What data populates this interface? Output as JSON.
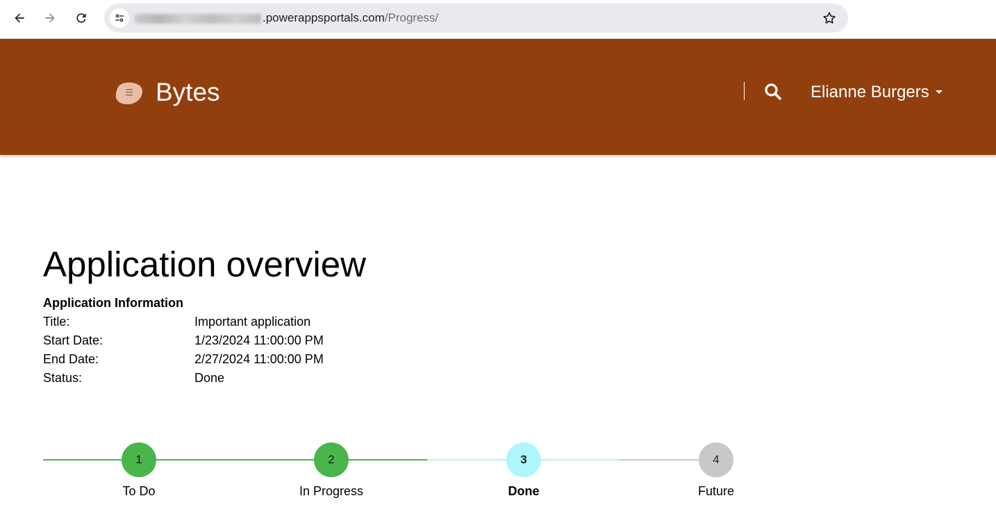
{
  "browser": {
    "url_host": ".powerappsportals.com",
    "url_path": "/Progress/"
  },
  "header": {
    "brand": "Bytes",
    "user_name": "Elianne Burgers",
    "colors": {
      "background": "#923f0e",
      "text": "#ffffff"
    }
  },
  "main": {
    "title": "Application overview",
    "info_heading": "Application Information",
    "info": [
      {
        "label": "Title:",
        "value": "Important application"
      },
      {
        "label": "Start Date:",
        "value": "1/23/2024 11:00:00 PM"
      },
      {
        "label": "End Date:",
        "value": "2/27/2024 11:00:00 PM"
      },
      {
        "label": "Status:",
        "value": "Done"
      }
    ]
  },
  "progress": {
    "steps": [
      {
        "number": "1",
        "label": "To Do",
        "state": "completed"
      },
      {
        "number": "2",
        "label": "In Progress",
        "state": "completed"
      },
      {
        "number": "3",
        "label": "Done",
        "state": "current"
      },
      {
        "number": "4",
        "label": "Future",
        "state": "upcoming"
      }
    ],
    "colors": {
      "completed": "#4ab54a",
      "current": "#aef6fb",
      "upcoming": "#c8c8c8"
    }
  }
}
